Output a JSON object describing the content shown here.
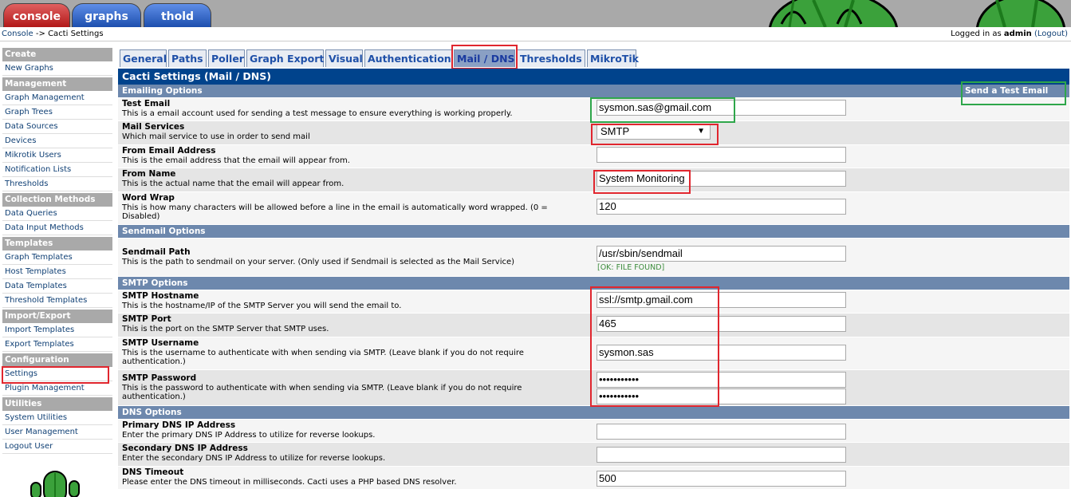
{
  "top_tabs": [
    "console",
    "graphs",
    "thold"
  ],
  "breadcrumb": {
    "link": "Console",
    "sep": "->",
    "current": "Cacti Settings"
  },
  "login": {
    "prefix": "Logged in as",
    "user": "admin",
    "logout": "(Logout)"
  },
  "sidebar": [
    {
      "type": "head",
      "label": "Create"
    },
    {
      "type": "item",
      "label": "New Graphs"
    },
    {
      "type": "head",
      "label": "Management"
    },
    {
      "type": "item",
      "label": "Graph Management"
    },
    {
      "type": "item",
      "label": "Graph Trees"
    },
    {
      "type": "item",
      "label": "Data Sources"
    },
    {
      "type": "item",
      "label": "Devices"
    },
    {
      "type": "item",
      "label": "Mikrotik Users"
    },
    {
      "type": "item",
      "label": "Notification Lists"
    },
    {
      "type": "item",
      "label": "Thresholds"
    },
    {
      "type": "head",
      "label": "Collection Methods"
    },
    {
      "type": "item",
      "label": "Data Queries"
    },
    {
      "type": "item",
      "label": "Data Input Methods"
    },
    {
      "type": "head",
      "label": "Templates"
    },
    {
      "type": "item",
      "label": "Graph Templates"
    },
    {
      "type": "item",
      "label": "Host Templates"
    },
    {
      "type": "item",
      "label": "Data Templates"
    },
    {
      "type": "item",
      "label": "Threshold Templates"
    },
    {
      "type": "head",
      "label": "Import/Export"
    },
    {
      "type": "item",
      "label": "Import Templates"
    },
    {
      "type": "item",
      "label": "Export Templates"
    },
    {
      "type": "head",
      "label": "Configuration"
    },
    {
      "type": "item",
      "label": "Settings",
      "active": true
    },
    {
      "type": "item",
      "label": "Plugin Management"
    },
    {
      "type": "head",
      "label": "Utilities"
    },
    {
      "type": "item",
      "label": "System Utilities"
    },
    {
      "type": "item",
      "label": "User Management"
    },
    {
      "type": "item",
      "label": "Logout User"
    }
  ],
  "tabs": [
    "General",
    "Paths",
    "Poller",
    "Graph Export",
    "Visual",
    "Authentication",
    "Mail / DNS",
    "Thresholds",
    "MikroTik"
  ],
  "active_tab": "Mail / DNS",
  "title": "Cacti Settings (Mail / DNS)",
  "send_test_email": "Send a Test Email",
  "sections": {
    "emailing": "Emailing Options",
    "sendmail": "Sendmail Options",
    "smtp": "SMTP Options",
    "dns": "DNS Options"
  },
  "fields": {
    "test_email": {
      "label": "Test Email",
      "desc": "This is a email account used for sending a test message to ensure everything is working properly.",
      "value": "sysmon.sas@gmail.com"
    },
    "mail_services": {
      "label": "Mail Services",
      "desc": "Which mail service to use in order to send mail",
      "value": "SMTP"
    },
    "from_email": {
      "label": "From Email Address",
      "desc": "This is the email address that the email will appear from.",
      "value": ""
    },
    "from_name": {
      "label": "From Name",
      "desc": "This is the actual name that the email will appear from.",
      "value": "System Monitoring"
    },
    "word_wrap": {
      "label": "Word Wrap",
      "desc": "This is how many characters will be allowed before a line in the email is automatically word wrapped. (0 = Disabled)",
      "value": "120"
    },
    "sendmail_path": {
      "label": "Sendmail Path",
      "desc": "This is the path to sendmail on your server. (Only used if Sendmail is selected as the Mail Service)",
      "value": "/usr/sbin/sendmail",
      "status": "[OK: FILE FOUND]"
    },
    "smtp_host": {
      "label": "SMTP Hostname",
      "desc": "This is the hostname/IP of the SMTP Server you will send the email to.",
      "value": "ssl://smtp.gmail.com"
    },
    "smtp_port": {
      "label": "SMTP Port",
      "desc": "This is the port on the SMTP Server that SMTP uses.",
      "value": "465"
    },
    "smtp_user": {
      "label": "SMTP Username",
      "desc": "This is the username to authenticate with when sending via SMTP. (Leave blank if you do not require authentication.)",
      "value": "sysmon.sas"
    },
    "smtp_pass": {
      "label": "SMTP Password",
      "desc": "This is the password to authenticate with when sending via SMTP. (Leave blank if you do not require authentication.)",
      "value": "•••••••••••",
      "confirm": "•••••••••••"
    },
    "dns_primary": {
      "label": "Primary DNS IP Address",
      "desc": "Enter the primary DNS IP Address to utilize for reverse lookups.",
      "value": ""
    },
    "dns_secondary": {
      "label": "Secondary DNS IP Address",
      "desc": "Enter the secondary DNS IP Address to utilize for reverse lookups.",
      "value": ""
    },
    "dns_timeout": {
      "label": "DNS Timeout",
      "desc": "Please enter the DNS timeout in milliseconds. Cacti uses a PHP based DNS resolver.",
      "value": "500"
    }
  },
  "colors": {
    "highlight_red": "#e0262e",
    "highlight_green": "#2ea64a",
    "header_blue": "#00438c",
    "section_blue": "#6d88ad"
  }
}
